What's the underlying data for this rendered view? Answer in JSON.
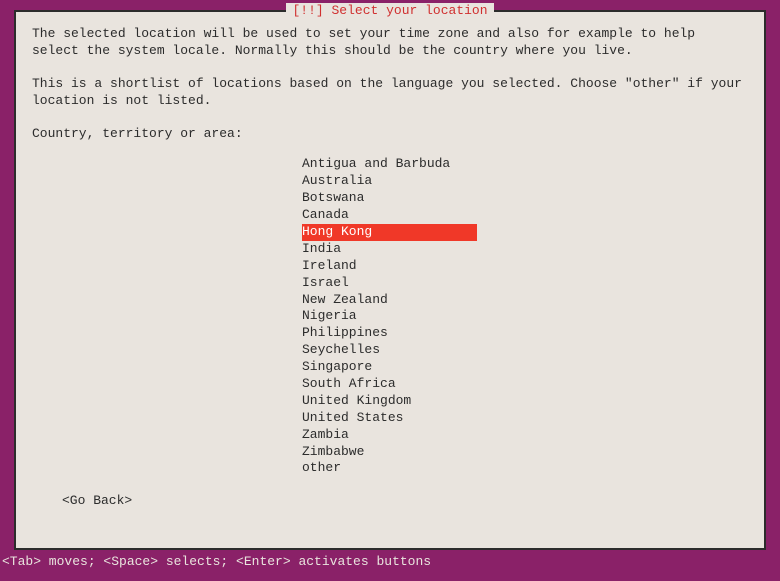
{
  "dialog": {
    "title_prefix": "[!!] ",
    "title": "Select your location",
    "paragraph1": "The selected location will be used to set your time zone and also for example to help select the system locale. Normally this should be the country where you live.",
    "paragraph2": "This is a shortlist of locations based on the language you selected. Choose \"other\" if your location is not listed.",
    "prompt": "Country, territory or area:",
    "countries": [
      "Antigua and Barbuda",
      "Australia",
      "Botswana",
      "Canada",
      "Hong Kong",
      "India",
      "Ireland",
      "Israel",
      "New Zealand",
      "Nigeria",
      "Philippines",
      "Seychelles",
      "Singapore",
      "South Africa",
      "United Kingdom",
      "United States",
      "Zambia",
      "Zimbabwe",
      "other"
    ],
    "selected_index": 4,
    "go_back": "<Go Back>"
  },
  "footer": "<Tab> moves; <Space> selects; <Enter> activates buttons"
}
